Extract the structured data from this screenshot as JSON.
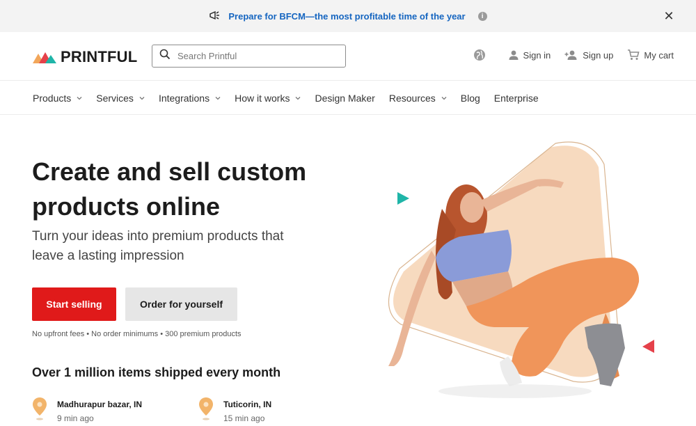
{
  "announcement": {
    "text": "Prepare for BFCM—the most profitable time of the year",
    "info_glyph": "i",
    "close_glyph": "✕",
    "icon": "megaphone-icon"
  },
  "header": {
    "logo_text": "PRINTFUL",
    "search_placeholder": "Search Printful",
    "sign_in": "Sign in",
    "sign_up": "Sign up",
    "cart": "My cart"
  },
  "nav": {
    "items": [
      {
        "label": "Products",
        "dropdown": true
      },
      {
        "label": "Services",
        "dropdown": true
      },
      {
        "label": "Integrations",
        "dropdown": true
      },
      {
        "label": "How it works",
        "dropdown": true
      },
      {
        "label": "Design Maker",
        "dropdown": false
      },
      {
        "label": "Resources",
        "dropdown": true
      },
      {
        "label": "Blog",
        "dropdown": false
      },
      {
        "label": "Enterprise",
        "dropdown": false
      }
    ]
  },
  "hero": {
    "title_line1": "Create and sell custom",
    "title_line2": "products online",
    "subtitle_line1": "Turn your ideas into premium products that",
    "subtitle_line2": "leave a lasting impression",
    "primary_cta": "Start selling",
    "secondary_cta": "Order for yourself",
    "fine_print": "No upfront fees • No order minimums • 300 premium products"
  },
  "shipped": {
    "heading": "Over 1 million items shipped every month",
    "locations": [
      {
        "city": "Madhurapur bazar, IN",
        "ago": "9 min ago"
      },
      {
        "city": "Tuticorin, IN",
        "ago": "15 min ago"
      }
    ]
  },
  "colors": {
    "brand_red": "#e01a1a",
    "link_blue": "#1565c0",
    "peach": "#f6d4b4",
    "teal": "#1fb5a8",
    "pin": "#f2b46a"
  }
}
